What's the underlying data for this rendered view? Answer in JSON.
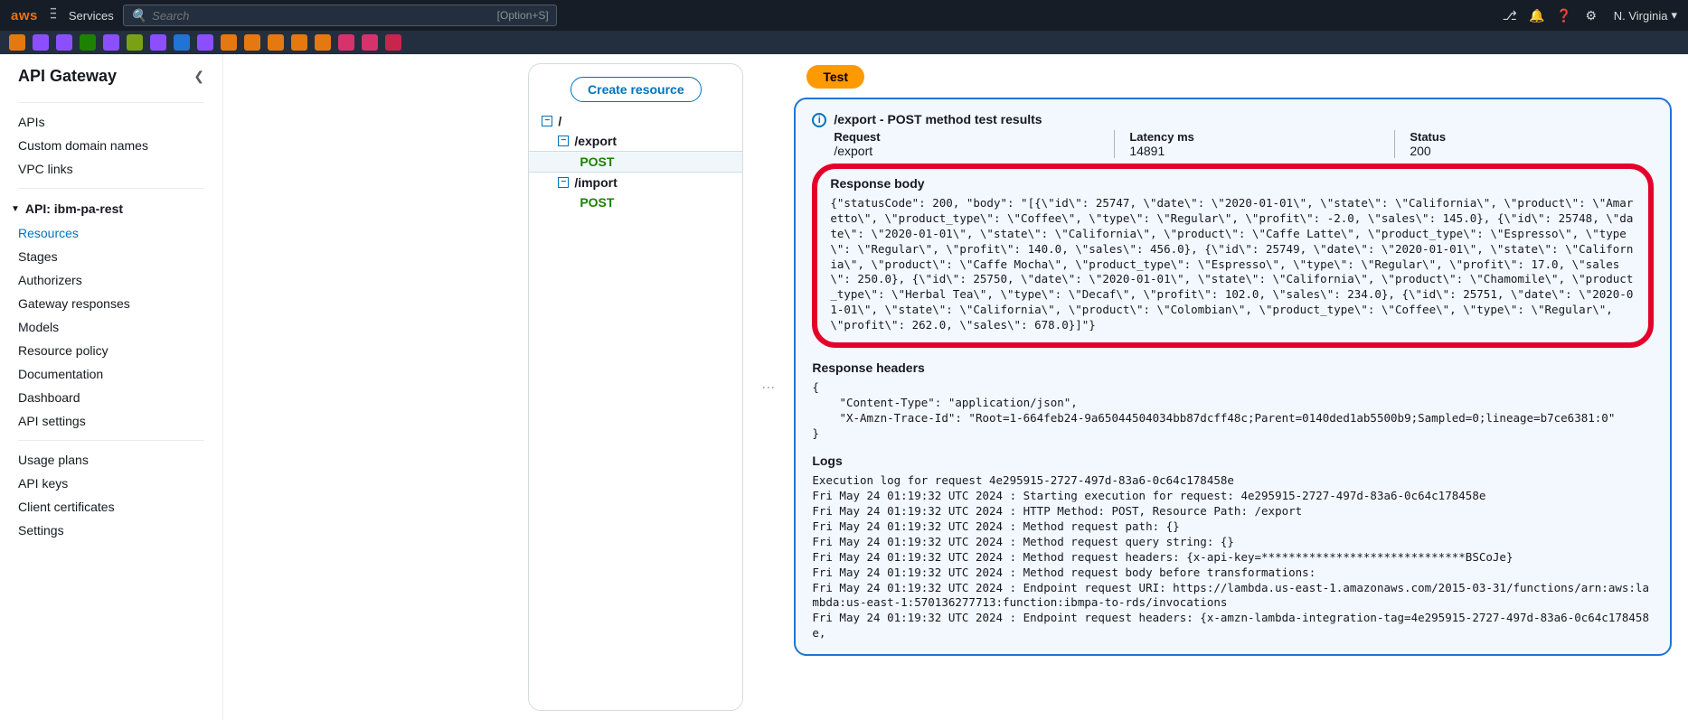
{
  "topnav": {
    "logo": "aws",
    "services": "Services",
    "search_placeholder": "Search",
    "search_kbd": "[Option+S]",
    "region": "N. Virginia"
  },
  "svc_chips": [
    "#e47911",
    "#8c4fff",
    "#8c4fff",
    "#1d8102",
    "#8c4fff",
    "#7aa116",
    "#8c4fff",
    "#2074d5",
    "#8c4fff",
    "#e47911",
    "#e47911",
    "#e47911",
    "#e47911",
    "#e47911",
    "#d6336c",
    "#d6336c",
    "#c7254e"
  ],
  "sidebar": {
    "title": "API Gateway",
    "top": [
      "APIs",
      "Custom domain names",
      "VPC links"
    ],
    "api_name": "API: ibm-pa-rest",
    "api_items": [
      "Resources",
      "Stages",
      "Authorizers",
      "Gateway responses",
      "Models",
      "Resource policy",
      "Documentation",
      "Dashboard",
      "API settings"
    ],
    "misc": [
      "Usage plans",
      "API keys",
      "Client certificates",
      "Settings"
    ]
  },
  "tree": {
    "create": "Create resource",
    "root": "/",
    "export": "/export",
    "export_post": "POST",
    "import": "/import",
    "import_post": "POST"
  },
  "results": {
    "test_btn": "Test",
    "title": "/export - POST method test results",
    "request_lbl": "Request",
    "request_val": "/export",
    "latency_lbl": "Latency ms",
    "latency_val": "14891",
    "status_lbl": "Status",
    "status_val": "200",
    "body_lbl": "Response body",
    "body_text": "{\"statusCode\": 200, \"body\": \"[{\\\"id\\\": 25747, \\\"date\\\": \\\"2020-01-01\\\", \\\"state\\\": \\\"California\\\", \\\"product\\\": \\\"Amaretto\\\", \\\"product_type\\\": \\\"Coffee\\\", \\\"type\\\": \\\"Regular\\\", \\\"profit\\\": -2.0, \\\"sales\\\": 145.0}, {\\\"id\\\": 25748, \\\"date\\\": \\\"2020-01-01\\\", \\\"state\\\": \\\"California\\\", \\\"product\\\": \\\"Caffe Latte\\\", \\\"product_type\\\": \\\"Espresso\\\", \\\"type\\\": \\\"Regular\\\", \\\"profit\\\": 140.0, \\\"sales\\\": 456.0}, {\\\"id\\\": 25749, \\\"date\\\": \\\"2020-01-01\\\", \\\"state\\\": \\\"California\\\", \\\"product\\\": \\\"Caffe Mocha\\\", \\\"product_type\\\": \\\"Espresso\\\", \\\"type\\\": \\\"Regular\\\", \\\"profit\\\": 17.0, \\\"sales\\\": 250.0}, {\\\"id\\\": 25750, \\\"date\\\": \\\"2020-01-01\\\", \\\"state\\\": \\\"California\\\", \\\"product\\\": \\\"Chamomile\\\", \\\"product_type\\\": \\\"Herbal Tea\\\", \\\"type\\\": \\\"Decaf\\\", \\\"profit\\\": 102.0, \\\"sales\\\": 234.0}, {\\\"id\\\": 25751, \\\"date\\\": \\\"2020-01-01\\\", \\\"state\\\": \\\"California\\\", \\\"product\\\": \\\"Colombian\\\", \\\"product_type\\\": \\\"Coffee\\\", \\\"type\\\": \\\"Regular\\\", \\\"profit\\\": 262.0, \\\"sales\\\": 678.0}]\"}",
    "headers_lbl": "Response headers",
    "headers_text": "{\n    \"Content-Type\": \"application/json\",\n    \"X-Amzn-Trace-Id\": \"Root=1-664feb24-9a65044504034bb87dcff48c;Parent=0140ded1ab5500b9;Sampled=0;lineage=b7ce6381:0\"\n}",
    "logs_lbl": "Logs",
    "logs_text": "Execution log for request 4e295915-2727-497d-83a6-0c64c178458e\nFri May 24 01:19:32 UTC 2024 : Starting execution for request: 4e295915-2727-497d-83a6-0c64c178458e\nFri May 24 01:19:32 UTC 2024 : HTTP Method: POST, Resource Path: /export\nFri May 24 01:19:32 UTC 2024 : Method request path: {}\nFri May 24 01:19:32 UTC 2024 : Method request query string: {}\nFri May 24 01:19:32 UTC 2024 : Method request headers: {x-api-key=******************************BSCoJe}\nFri May 24 01:19:32 UTC 2024 : Method request body before transformations:\nFri May 24 01:19:32 UTC 2024 : Endpoint request URI: https://lambda.us-east-1.amazonaws.com/2015-03-31/functions/arn:aws:lambda:us-east-1:570136277713:function:ibmpa-to-rds/invocations\nFri May 24 01:19:32 UTC 2024 : Endpoint request headers: {x-amzn-lambda-integration-tag=4e295915-2727-497d-83a6-0c64c178458e,"
  }
}
